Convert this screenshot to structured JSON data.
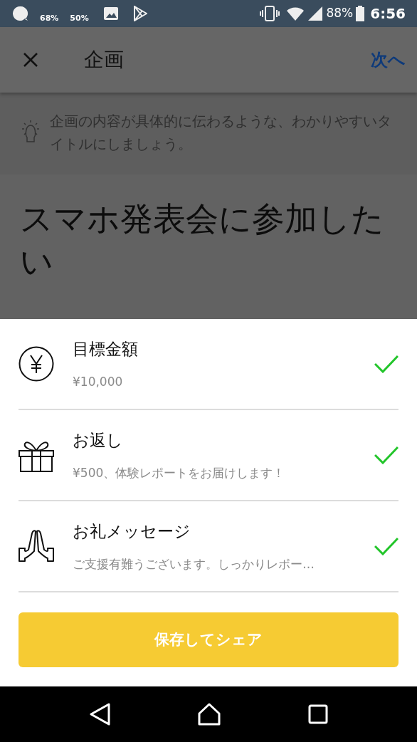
{
  "status_bar": {
    "indicators": [
      "68%",
      "50%"
    ],
    "battery": "88%",
    "time": "6:56"
  },
  "app_bar": {
    "title": "企画",
    "next": "次へ"
  },
  "hint": "企画の内容が具体的に伝わるような、わかりやすいタイトルにしましょう。",
  "project_title": "スマホ発表会に参加したい",
  "sheet": {
    "items": [
      {
        "kind": "yen",
        "label": "目標金額",
        "value": "¥10,000",
        "checked": true
      },
      {
        "kind": "gift",
        "label": "お返し",
        "value": "¥500、体験レポートをお届けします！",
        "checked": true
      },
      {
        "kind": "thanks",
        "label": "お礼メッセージ",
        "value": "ご支援有難うございます。しっかりレポー…",
        "checked": true
      }
    ],
    "button": "保存してシェア"
  }
}
